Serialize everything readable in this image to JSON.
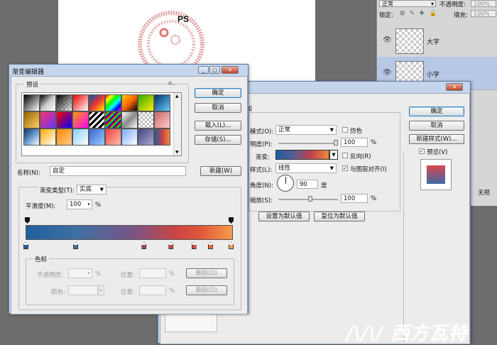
{
  "layers_panel": {
    "blend_mode": "正常",
    "opacity_label": "不透明度:",
    "opacity_value": "100%",
    "lock_label": "锁定:",
    "fill_label": "填充:",
    "fill_value": "100%",
    "layers": [
      {
        "name": "大字",
        "selected": false
      },
      {
        "name": "小字",
        "selected": true
      }
    ],
    "side_text": "无视"
  },
  "canvas": {
    "text": "PS"
  },
  "layer_style": {
    "section_title": "加",
    "blend_mode_label": "模式(O):",
    "blend_mode_value": "正常",
    "dither_label": "仿色",
    "opacity_label": "明度(P):",
    "opacity_value": "100",
    "opacity_unit": "%",
    "gradient_label": "渐变:",
    "reverse_label": "反向(R)",
    "style_label": "样式(L):",
    "style_value": "线性",
    "align_label": "与图层对齐(I)",
    "angle_label": "角度(N):",
    "angle_value": "90",
    "angle_unit": "度",
    "scale_label": "缩放(S):",
    "scale_value": "100",
    "scale_unit": "%",
    "set_default": "设置为默认值",
    "reset_default": "复位为默认值",
    "ok": "确定",
    "cancel": "取消",
    "new_style": "新建样式(W)...",
    "preview_label": "预览(V)"
  },
  "gradient_editor": {
    "title": "渐变编辑器",
    "presets_label": "预设",
    "gear": "☼.",
    "ok": "确定",
    "cancel": "取消",
    "load": "载入(L)...",
    "save": "存储(S)...",
    "name_label": "名称(N):",
    "name_value": "自定",
    "new_button": "新建(W)",
    "type_label": "渐变类型(T):",
    "type_value": "实底",
    "smooth_label": "平滑度(M):",
    "smooth_value": "100",
    "smooth_unit": "%",
    "stops_group": "色标",
    "opacity_label": "不透明度:",
    "color_label": "颜色:",
    "location_label": "位置:",
    "percent": "%",
    "delete_label": "删除(D)",
    "stop_colors": [
      "#1f5f9c",
      "#3f70a4",
      "#a24452",
      "#c94444",
      "#d9493e",
      "#ea6a3a",
      "#f4a050"
    ]
  },
  "watermark": "/\\/\\/ 西方瓦特"
}
